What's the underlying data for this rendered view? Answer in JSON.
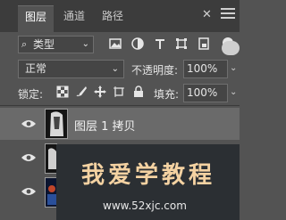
{
  "tabs": [
    {
      "label": "图层",
      "active": true
    },
    {
      "label": "通道",
      "active": false
    },
    {
      "label": "路径",
      "active": false
    }
  ],
  "tab_close": "✕",
  "filter": {
    "selected": "类型"
  },
  "filter_icons": [
    "image-icon",
    "adjustment-icon",
    "type-icon",
    "shape-icon",
    "smart-object-icon"
  ],
  "blend": {
    "mode": "正常",
    "opacity_label": "不透明度:",
    "opacity_value": "100%"
  },
  "lock": {
    "label": "锁定:",
    "fill_label": "填充:",
    "fill_value": "100%"
  },
  "layers": [
    {
      "name": "图层 1 拷贝"
    },
    {
      "name": ""
    },
    {
      "name": ""
    }
  ],
  "watermark": {
    "title": "我爱学教程",
    "url": "www.52xjc.com"
  },
  "colors": {
    "panel": "#535353",
    "tabbar": "#3c3c3c",
    "selected_row": "#6a6a6a",
    "watermark_text": "#f4d2a2"
  }
}
